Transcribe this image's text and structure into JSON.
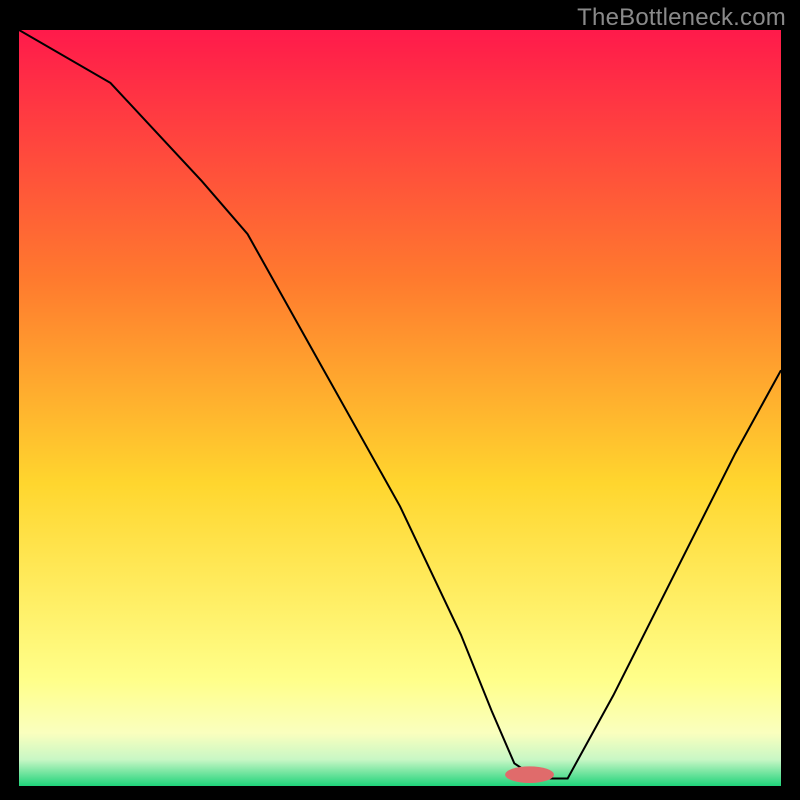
{
  "watermark": "TheBottleneck.com",
  "chart_data": {
    "type": "line",
    "title": "",
    "xlabel": "",
    "ylabel": "",
    "xlim": [
      0,
      100
    ],
    "ylim": [
      0,
      100
    ],
    "grid": false,
    "legend": false,
    "gradient_stops": [
      {
        "offset": 0.0,
        "color": "#ff1a4b"
      },
      {
        "offset": 0.33,
        "color": "#ff7a2e"
      },
      {
        "offset": 0.6,
        "color": "#ffd62e"
      },
      {
        "offset": 0.86,
        "color": "#ffff8a"
      },
      {
        "offset": 0.93,
        "color": "#faffbe"
      },
      {
        "offset": 0.965,
        "color": "#c8f7c5"
      },
      {
        "offset": 1.0,
        "color": "#1fd37a"
      }
    ],
    "marker": {
      "x": 67,
      "y": 98.5,
      "rx": 3.2,
      "ry": 1.1,
      "fill": "#e06b6b"
    },
    "series": [
      {
        "name": "bottleneck-curve",
        "x": [
          0,
          12,
          24,
          30,
          40,
          50,
          58,
          62,
          65,
          68,
          72,
          78,
          86,
          94,
          100
        ],
        "values": [
          100,
          93,
          80,
          73,
          55,
          37,
          20,
          10,
          3,
          1,
          1,
          12,
          28,
          44,
          55
        ]
      }
    ]
  }
}
